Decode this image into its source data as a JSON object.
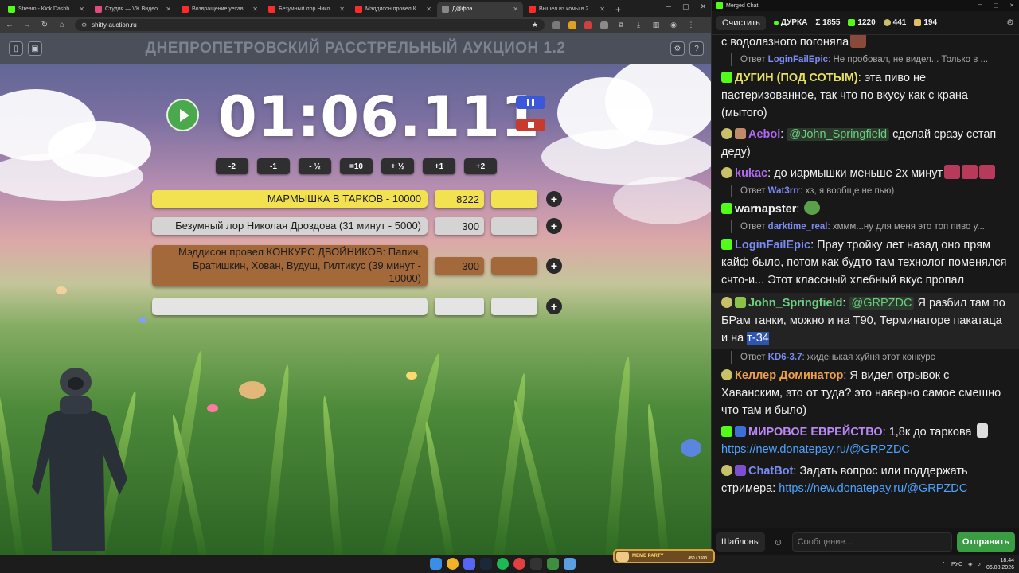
{
  "browser": {
    "tabs": [
      {
        "title": "Stream - Kick Dashboard",
        "color": "#53fc18",
        "active": false
      },
      {
        "title": "Студия — VK Видео Live",
        "color": "#e34a7f",
        "active": false
      },
      {
        "title": "Возвращение уехавших ст",
        "color": "#ff2a2a",
        "active": false
      },
      {
        "title": "Безумный лор Николая Др",
        "color": "#ff2a2a",
        "active": false
      },
      {
        "title": "Мэддисон провел КОНКУР",
        "color": "#ff2a2a",
        "active": false
      },
      {
        "title": "Д@фра",
        "color": "#888888",
        "active": true
      },
      {
        "title": "Вышел из комы в 2026 год",
        "color": "#ff2a2a",
        "active": false
      }
    ],
    "new_tab": "+",
    "url": "shitty-auction.ru"
  },
  "auction": {
    "title": "ДНЕПРОПЕТРОВСКИЙ РАССТРЕЛЬНЫЙ АУКЦИОН 1.2",
    "timer": "01:06.111",
    "adjust_buttons": [
      "-2",
      "-1",
      "- ½",
      "=10",
      "+ ½",
      "+1",
      "+2"
    ],
    "lots": [
      {
        "name": "МАРМЫШКА В ТАРКОВ - 10000",
        "amount": "8222",
        "color": "#f2e150"
      },
      {
        "name": "Безумный лор Николая Дроздова (31 минут - 5000)",
        "amount": "300",
        "color": "#d4d4d4"
      },
      {
        "name": "Мэддисон провел КОНКУРС ДВОЙНИКОВ: Папич, Братишкин, Хован, Вудуш, Гилтикус (39 минут - 10000)",
        "amount": "300",
        "color": "#a3693a"
      },
      {
        "name": "",
        "amount": "",
        "color": "#e4e4e4"
      }
    ],
    "plus": "+"
  },
  "chat": {
    "window_title": "Merged Chat",
    "clear_label": "Очистить",
    "channel": "ДУРКА",
    "total": "Σ 1855",
    "kick_count": "1220",
    "twitch_count": "441",
    "vk_count": "194",
    "top_fragment": "с водолазного погоняла",
    "messages": [
      {
        "reply_to": "LoginFailEpic",
        "reply_text": "Не пробовал, не видел... Только в ...",
        "nick": "",
        "text": ""
      },
      {
        "nick": "ДУГИН (ПОД СОТЫМ)",
        "nick_color": "#e6e05c",
        "badge": "kick",
        "text": "эта пиво не пастеризованное, так что по вкусу как с крана (мытого)"
      },
      {
        "nick": "Aeboi",
        "nick_color": "#b06af2",
        "badge": "emo",
        "mention": "@John_Springfield",
        "text": "сделай сразу сетап деду)"
      },
      {
        "nick": "kukac",
        "nick_color": "#b06af2",
        "badge": "emo",
        "text": "до иармышки меньше 2х минут"
      },
      {
        "reply_to": "Wat3rrr",
        "reply_text": "хз, я вообще не пью)"
      },
      {
        "nick": "warnapster",
        "nick_color": "#eeeeee",
        "badge": "kick",
        "text": ""
      },
      {
        "reply_to": "darktime_real",
        "reply_text": "хммм...ну для меня это топ пиво у..."
      },
      {
        "nick": "LoginFailEpic",
        "nick_color": "#7b8bf2",
        "badge": "kick",
        "text": "Прау тройку лет назад оно прям кайф было, потом как будто там технолог поменялся счто-и... Этот классный хлебный вкус пропал"
      },
      {
        "nick": "John_Springfield",
        "nick_color": "#6bcf7f",
        "badge": "emo",
        "mention": "@GRPZDC",
        "text_a": "Я разбил там по БРам танки, можно и на Т90, Терминаторе пакатаца и на",
        "text_sel": "т-34"
      },
      {
        "reply_to": "KD6-3.7",
        "reply_text": "жиденькая хуйня этот конкурс"
      },
      {
        "nick": "Келлер Доминатор",
        "nick_color": "#f0a04a",
        "badge": "emo",
        "text": "Я видел отрывок с Хаванским, это от туда? это наверно самое смешно что там и было)"
      },
      {
        "nick": "МИРОВОЕ ЕВРЕЙСТВО",
        "nick_color": "#b98af5",
        "badge": "kick",
        "text": "1,8к до таркова",
        "link": "https://new.donatepay.ru/@GRPZDC"
      },
      {
        "nick": "ChatBot",
        "nick_color": "#7b8bf2",
        "badge": "emo",
        "text": "Задать вопрос или поддержать стримера:",
        "link": "https://new.donatepay.ru/@GRPZDC"
      }
    ],
    "templates_label": "Шаблоны",
    "input_placeholder": "Сообщение...",
    "send_label": "Отправить"
  },
  "taskbar": {
    "lang": "РУС",
    "time": "18:44",
    "date": "06.08.2026",
    "meme_label": "MEME PARTY",
    "meme_count": "450 / 1500"
  }
}
